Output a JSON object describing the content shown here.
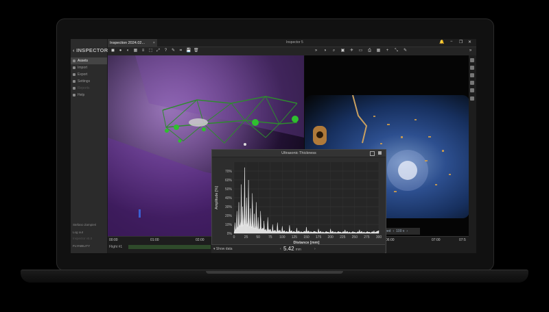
{
  "app": {
    "brand": "INSPECTOR",
    "window_title": "Inspector 5",
    "tab_label": "Inspection 2024.02...",
    "tab_close": "×"
  },
  "sidebar": {
    "items": [
      {
        "label": "Assets",
        "active": true
      },
      {
        "label": "Import",
        "active": false
      },
      {
        "label": "Export",
        "active": false
      },
      {
        "label": "Settings",
        "active": false
      },
      {
        "label": "Reports",
        "active": false,
        "dim": true
      },
      {
        "label": "Help",
        "active": false
      }
    ],
    "user": "Stefano Zampieri",
    "logout": "Log out",
    "version": "Inspector v5.0",
    "company": "FLYABILITY"
  },
  "toolbar": {
    "left_icons": [
      "cube-icon",
      "sphere-icon",
      "sphere-alt-icon",
      "grid-icon",
      "layers-icon",
      "box-icon",
      "transform-icon",
      "help-icon",
      "pen-icon",
      "crop-icon",
      "save-icon",
      "trash-icon"
    ],
    "right_icons": [
      "forward-icon",
      "contrast-icon",
      "zoom-icon",
      "camera-icon",
      "drone-icon",
      "frame-icon",
      "snapshot-icon",
      "grid-icon",
      "crosshair-icon",
      "measure-icon",
      "pencil-icon"
    ],
    "more": "»"
  },
  "chart_panel": {
    "title": "Ultrasonic Thickness"
  },
  "chart_data": {
    "type": "area",
    "title": "Ultrasonic Thickness",
    "xlabel": "Distance [mm]",
    "ylabel": "Amplitude [%]",
    "xlim": [
      0,
      300
    ],
    "ylim": [
      0,
      80
    ],
    "xticks": [
      0,
      25,
      50,
      75,
      100,
      125,
      150,
      175,
      200,
      225,
      250,
      275,
      300
    ],
    "yticks": [
      0,
      10,
      20,
      30,
      40,
      50,
      60,
      70
    ],
    "ytick_suffix": "%",
    "peaks": [
      {
        "x": 2,
        "y": 12
      },
      {
        "x": 6,
        "y": 25
      },
      {
        "x": 10,
        "y": 35
      },
      {
        "x": 15,
        "y": 55
      },
      {
        "x": 18,
        "y": 30
      },
      {
        "x": 22,
        "y": 74
      },
      {
        "x": 26,
        "y": 40
      },
      {
        "x": 30,
        "y": 60
      },
      {
        "x": 34,
        "y": 28
      },
      {
        "x": 38,
        "y": 45
      },
      {
        "x": 42,
        "y": 22
      },
      {
        "x": 46,
        "y": 35
      },
      {
        "x": 50,
        "y": 18
      },
      {
        "x": 55,
        "y": 25
      },
      {
        "x": 62,
        "y": 14
      },
      {
        "x": 70,
        "y": 18
      },
      {
        "x": 80,
        "y": 10
      },
      {
        "x": 90,
        "y": 12
      },
      {
        "x": 100,
        "y": 8
      },
      {
        "x": 115,
        "y": 9
      },
      {
        "x": 130,
        "y": 6
      },
      {
        "x": 150,
        "y": 7
      },
      {
        "x": 175,
        "y": 5
      },
      {
        "x": 200,
        "y": 5
      },
      {
        "x": 230,
        "y": 4
      },
      {
        "x": 260,
        "y": 4
      },
      {
        "x": 290,
        "y": 3
      }
    ],
    "color": "#ffffff"
  },
  "measurement": {
    "value": "5.42",
    "unit": "mm",
    "toggle": "Show data"
  },
  "playback": {
    "speed_label": "Speed",
    "speed_value": "100 x"
  },
  "timeline": {
    "ticks": [
      "00:00",
      "01:00",
      "02:00",
      "06:00",
      "07:00",
      "07:5"
    ],
    "flight_label": "Flight #1"
  },
  "colors": {
    "accent": "#3ca03c",
    "pointcloud": "#8a3ccf",
    "bg": "#1d1d1d"
  }
}
